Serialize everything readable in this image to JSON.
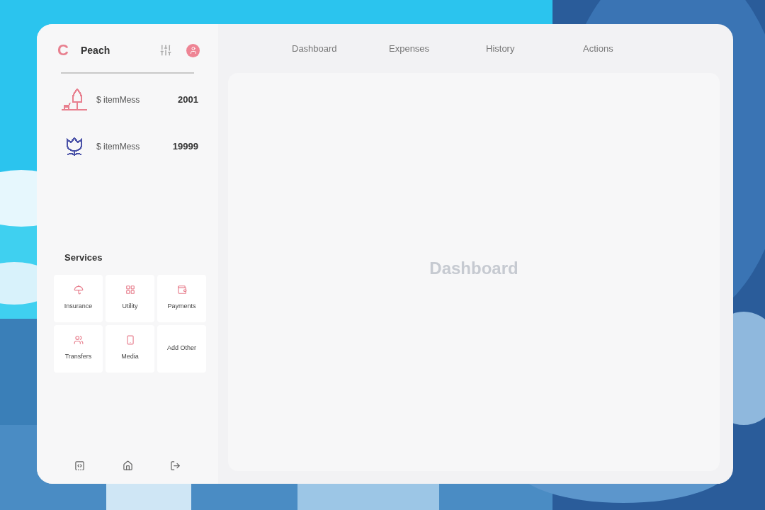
{
  "brand": {
    "logo": "C",
    "name": "Peach"
  },
  "tabs": [
    {
      "label": "Dashboard",
      "selected": false
    },
    {
      "label": "Expenses",
      "selected": false
    },
    {
      "label": "History",
      "selected": false
    },
    {
      "label": "Actions",
      "selected": false
    }
  ],
  "items": [
    {
      "kind": "tree",
      "label": "$ itemMess",
      "value": "2001",
      "color": "#e8808f"
    },
    {
      "kind": "tulip",
      "label": "$ itemMess",
      "value": "19999",
      "color": "#4a52a8"
    }
  ],
  "services": {
    "title": "Services",
    "tiles": [
      {
        "kind": "umbrella",
        "label": "Insurance"
      },
      {
        "kind": "grid",
        "label": "Utility"
      },
      {
        "kind": "wallet",
        "label": "Payments"
      },
      {
        "kind": "users",
        "label": "Transfers"
      },
      {
        "kind": "phone",
        "label": "Media"
      },
      {
        "kind": "none",
        "label": "Add Other"
      }
    ]
  },
  "main": {
    "heading": "Dashboard"
  }
}
